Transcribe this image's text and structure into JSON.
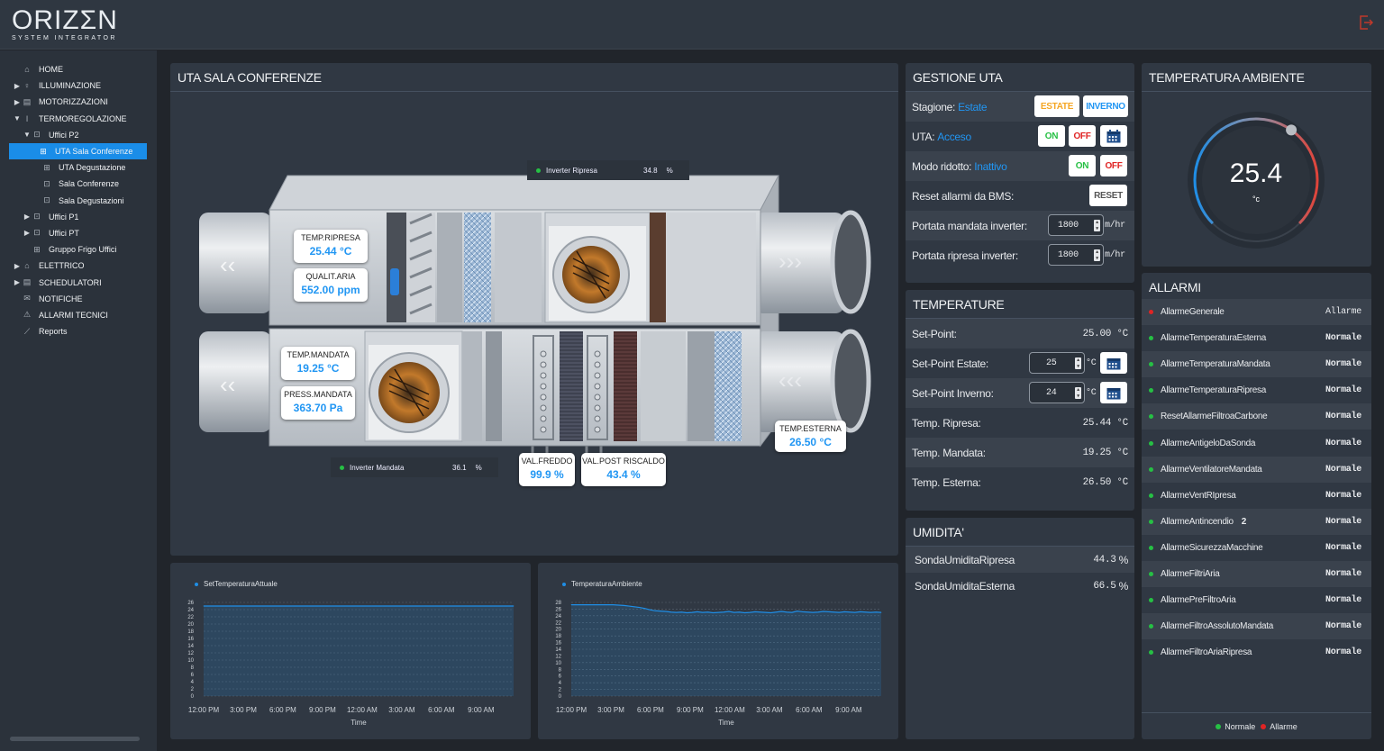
{
  "brand": {
    "name": "ORIZΣN",
    "tagline": "SYSTEM INTEGRATOR"
  },
  "sidebar": {
    "items": [
      {
        "label": "HOME",
        "icon": "home-icon",
        "caret": ""
      },
      {
        "label": "ILLUMINAZIONE",
        "icon": "bulb-icon",
        "caret": "▶"
      },
      {
        "label": "MOTORIZZAZIONI",
        "icon": "calendar-icon",
        "caret": "▶"
      },
      {
        "label": "TERMOREGOLAZIONE",
        "icon": "thermometer-icon",
        "caret": "▼"
      },
      {
        "label": "Uffici P2",
        "icon": "floorplan-icon",
        "caret": "▼"
      },
      {
        "label": "UTA Sala Conferenze",
        "icon": "grid-icon",
        "caret": ""
      },
      {
        "label": "UTA Degustazione",
        "icon": "grid-icon",
        "caret": ""
      },
      {
        "label": "Sala Conferenze",
        "icon": "floorplan-icon",
        "caret": ""
      },
      {
        "label": "Sala Degustazioni",
        "icon": "floorplan-icon",
        "caret": ""
      },
      {
        "label": "Uffici P1",
        "icon": "floorplan-icon",
        "caret": "▶"
      },
      {
        "label": "Uffici PT",
        "icon": "floorplan-icon",
        "caret": "▶"
      },
      {
        "label": "Gruppo Frigo Uffici",
        "icon": "grid-icon",
        "caret": ""
      },
      {
        "label": "ELETTRICO",
        "icon": "plug-icon",
        "caret": "▶"
      },
      {
        "label": "SCHEDULATORI",
        "icon": "calendar-icon",
        "caret": "▶"
      },
      {
        "label": "NOTIFICHE",
        "icon": "mail-icon",
        "caret": ""
      },
      {
        "label": "ALLARMI TECNICI",
        "icon": "bell-icon",
        "caret": ""
      },
      {
        "label": "Reports",
        "icon": "chart-icon",
        "caret": ""
      }
    ]
  },
  "uta": {
    "title": "UTA SALA CONFERENZE",
    "inverter_ripresa": {
      "label": "Inverter Ripresa",
      "value": "34.8",
      "unit": "%"
    },
    "inverter_mandata": {
      "label": "Inverter Mandata",
      "value": "36.1",
      "unit": "%"
    },
    "temp_ripresa": {
      "label": "TEMP.RIPRESA",
      "value": "25.44 °C"
    },
    "qualit_aria": {
      "label": "QUALIT.ARIA",
      "value": "552.00 ppm"
    },
    "temp_mandata": {
      "label": "TEMP.MANDATA",
      "value": "19.25 °C"
    },
    "press_mandata": {
      "label": "PRESS.MANDATA",
      "value": "363.70 Pa"
    },
    "val_freddo": {
      "label": "VAL.FREDDO",
      "value": "99.9 %"
    },
    "val_post": {
      "label": "VAL.POST RISCALDO",
      "value": "43.4 %"
    },
    "temp_esterna": {
      "label": "TEMP.ESTERNA",
      "value": "26.50 °C"
    }
  },
  "gestione": {
    "title": "GESTIONE UTA",
    "stagione": {
      "label": "Stagione:",
      "value": "Estate",
      "btn_estate": "ESTATE",
      "btn_inverno": "INVERNO"
    },
    "uta": {
      "label": "UTA:",
      "value": "Acceso",
      "on": "ON",
      "off": "OFF"
    },
    "modo": {
      "label": "Modo ridotto:",
      "value": "Inattivo",
      "on": "ON",
      "off": "OFF"
    },
    "reset": {
      "label": "Reset allarmi da BMS:",
      "btn": "RESET"
    },
    "portata_mandata": {
      "label": "Portata mandata inverter:",
      "value": "1800",
      "unit": "m/hr"
    },
    "portata_ripresa": {
      "label": "Portata ripresa inverter:",
      "value": "1800",
      "unit": "m/hr"
    }
  },
  "temperature": {
    "title": "TEMPERATURE",
    "setpoint": {
      "label": "Set-Point:",
      "value": "25.00 °C"
    },
    "setpoint_estate": {
      "label": "Set-Point Estate:",
      "value": "25",
      "unit": "°C"
    },
    "setpoint_inverno": {
      "label": "Set-Point Inverno:",
      "value": "24",
      "unit": "°C"
    },
    "ripresa": {
      "label": "Temp. Ripresa:",
      "value": "25.44 °C"
    },
    "mandata": {
      "label": "Temp. Mandata:",
      "value": "19.25 °C"
    },
    "esterna": {
      "label": "Temp. Esterna:",
      "value": "26.50 °C"
    }
  },
  "umidita": {
    "title": "UMIDITA'",
    "rows": [
      {
        "label": "SondaUmiditaRipresa",
        "value": "44.3",
        "unit": "%"
      },
      {
        "label": "SondaUmiditaEsterna",
        "value": "66.5",
        "unit": "%"
      }
    ]
  },
  "ambiente": {
    "title": "TEMPERATURA AMBIENTE",
    "value": "25.4",
    "unit": "°c",
    "fraction": 0.63
  },
  "allarmi": {
    "title": "ALLARMI",
    "rows": [
      {
        "name": "AllarmeGenerale",
        "status": "Allarme",
        "color": "#e02424",
        "badge": ""
      },
      {
        "name": "AllarmeTemperaturaEsterna",
        "status": "Normale",
        "color": "#26c044",
        "badge": ""
      },
      {
        "name": "AllarmeTemperaturaMandata",
        "status": "Normale",
        "color": "#26c044",
        "badge": ""
      },
      {
        "name": "AllarmeTemperaturaRipresa",
        "status": "Normale",
        "color": "#26c044",
        "badge": ""
      },
      {
        "name": "ResetAllarmeFiltroaCarbone",
        "status": "Normale",
        "color": "#26c044",
        "badge": ""
      },
      {
        "name": "AllarmeAntigeloDaSonda",
        "status": "Normale",
        "color": "#26c044",
        "badge": ""
      },
      {
        "name": "AllarmeVentilatoreMandata",
        "status": "Normale",
        "color": "#26c044",
        "badge": ""
      },
      {
        "name": "AllarmeVentRIpresa",
        "status": "Normale",
        "color": "#26c044",
        "badge": ""
      },
      {
        "name": "AllarmeAntincendio",
        "status": "Normale",
        "color": "#26c044",
        "badge": "2"
      },
      {
        "name": "AllarmeSicurezzaMacchine",
        "status": "Normale",
        "color": "#26c044",
        "badge": ""
      },
      {
        "name": "AllarmeFiltriAria",
        "status": "Normale",
        "color": "#26c044",
        "badge": ""
      },
      {
        "name": "AllarmePreFiltroAria",
        "status": "Normale",
        "color": "#26c044",
        "badge": ""
      },
      {
        "name": "AllarmeFiltroAssolutoMandata",
        "status": "Normale",
        "color": "#26c044",
        "badge": ""
      },
      {
        "name": "AllarmeFiltroAriaRipresa",
        "status": "Normale",
        "color": "#26c044",
        "badge": ""
      }
    ],
    "legend": [
      {
        "label": "Normale",
        "color": "#26c044"
      },
      {
        "label": "Allarme",
        "color": "#e02424"
      }
    ]
  },
  "chart_data": [
    {
      "type": "area",
      "series": [
        {
          "name": "SetTemperaturaAttuale",
          "values": [
            25,
            25,
            25,
            25,
            25,
            25,
            25,
            25,
            25,
            25,
            25,
            25,
            25,
            25,
            25,
            25,
            25,
            25,
            25,
            25,
            25,
            25,
            25,
            25,
            25,
            25,
            25,
            25,
            25,
            25,
            25,
            25,
            25,
            25,
            25,
            25,
            25,
            25,
            25,
            25,
            25,
            25,
            25,
            25,
            25,
            25,
            25,
            25,
            25,
            25,
            25,
            25,
            25,
            25,
            25,
            25,
            25,
            25,
            25,
            25
          ]
        }
      ],
      "x_ticks": [
        "12:00 PM",
        "3:00 PM",
        "6:00 PM",
        "9:00 PM",
        "12:00 AM",
        "3:00 AM",
        "6:00 AM",
        "9:00 AM"
      ],
      "y_ticks": [
        0,
        2,
        4,
        6,
        8,
        10,
        12,
        14,
        16,
        18,
        20,
        22,
        24,
        26
      ],
      "ylim": [
        0,
        26
      ],
      "xlabel": "Time",
      "ylabel": ""
    },
    {
      "type": "area",
      "series": [
        {
          "name": "TemperaturaAmbiente",
          "values": [
            27.3,
            27.3,
            27.3,
            27.3,
            27.3,
            27.3,
            27.3,
            27.3,
            27.3,
            27.2,
            27.1,
            26.9,
            26.7,
            26.5,
            26.2,
            25.8,
            25.5,
            25.4,
            25.3,
            25.1,
            25.0,
            25.1,
            24.9,
            25.0,
            25.2,
            25.0,
            25.1,
            24.9,
            25.0,
            25.1,
            25.3,
            25.0,
            25.1,
            24.9,
            25.0,
            25.2,
            25.1,
            25.0,
            24.9,
            25.1,
            25.3,
            25.1,
            25.0,
            25.4,
            25.2,
            25.1,
            25.0,
            25.1,
            25.3,
            25.2,
            25.1,
            25.0,
            25.2,
            25.1,
            25.0,
            25.2,
            25.1,
            25.0,
            25.1,
            25.0
          ]
        }
      ],
      "x_ticks": [
        "12:00 PM",
        "3:00 PM",
        "6:00 PM",
        "9:00 PM",
        "12:00 AM",
        "3:00 AM",
        "6:00 AM",
        "9:00 AM"
      ],
      "y_ticks": [
        0,
        2,
        4,
        6,
        8,
        10,
        12,
        14,
        16,
        18,
        20,
        22,
        24,
        26,
        28
      ],
      "ylim": [
        0,
        28
      ],
      "xlabel": "Time",
      "ylabel": ""
    }
  ]
}
